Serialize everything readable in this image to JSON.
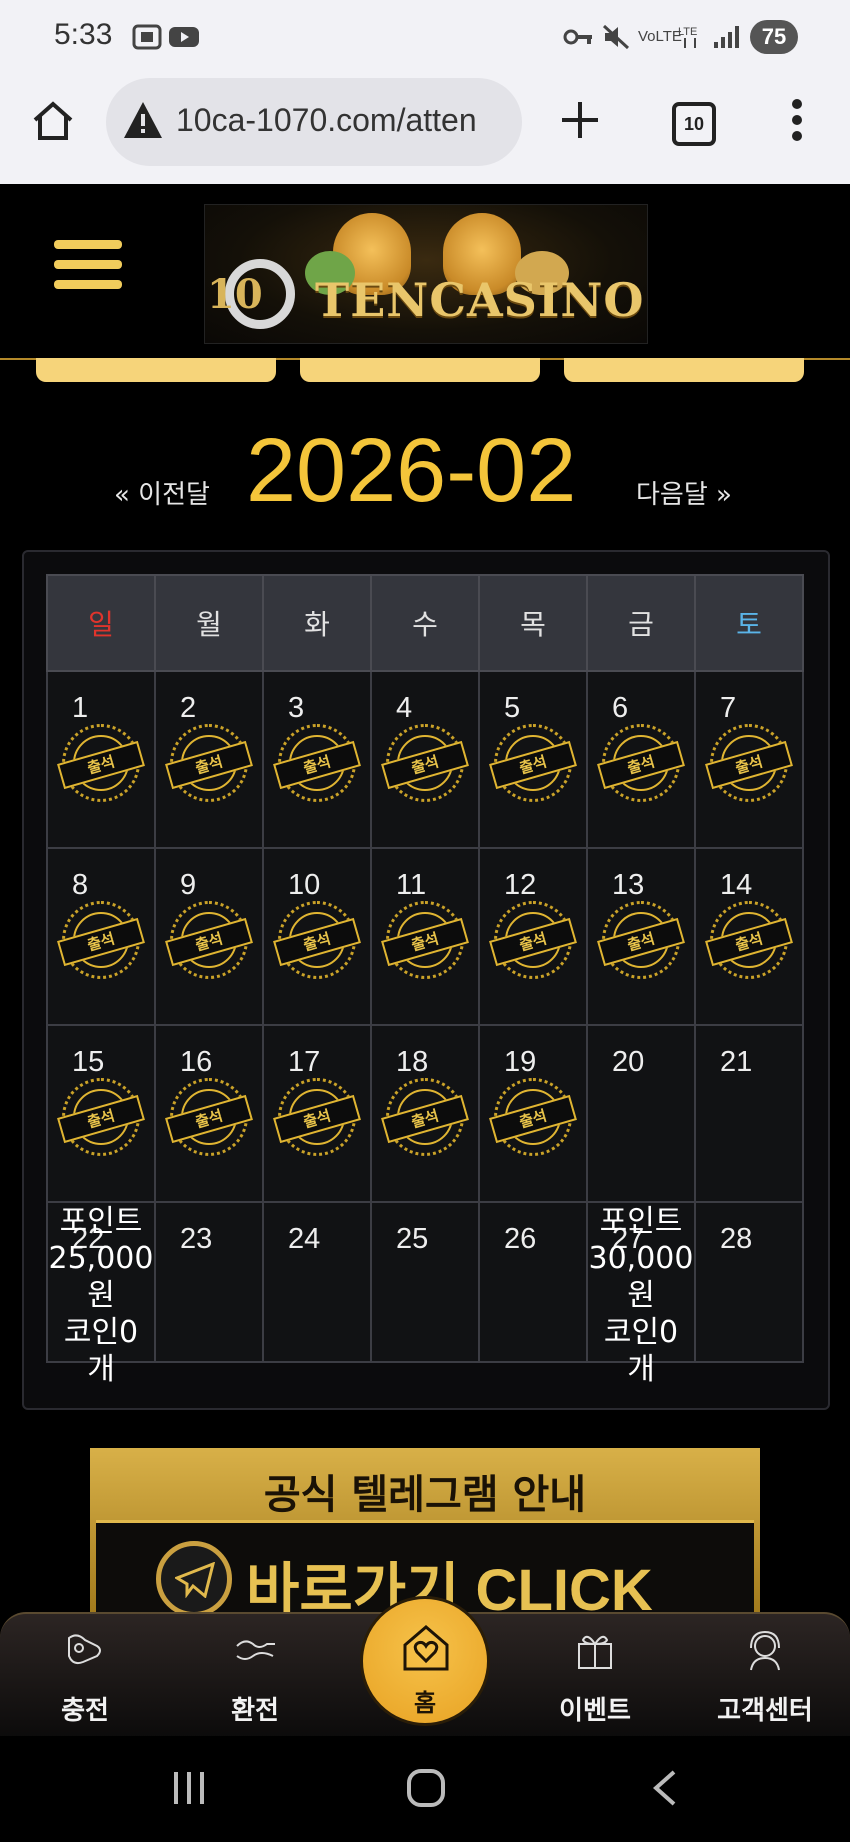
{
  "status_bar": {
    "time": "5:33",
    "battery": "75"
  },
  "browser": {
    "url": "10ca-1070.com/atten",
    "tab_count": "10"
  },
  "site": {
    "logo_text": "TENCASINO",
    "logo_prefix": "10"
  },
  "calendar": {
    "prev_label": "« 이전달",
    "next_label": "다음달 »",
    "month": "2026-02",
    "weekdays": [
      "일",
      "월",
      "화",
      "수",
      "목",
      "금",
      "토"
    ],
    "stamp_text": "출석",
    "weeks": [
      [
        {
          "day": "1",
          "stamp": true
        },
        {
          "day": "2",
          "stamp": true
        },
        {
          "day": "3",
          "stamp": true
        },
        {
          "day": "4",
          "stamp": true
        },
        {
          "day": "5",
          "stamp": true
        },
        {
          "day": "6",
          "stamp": true
        },
        {
          "day": "7",
          "stamp": true
        }
      ],
      [
        {
          "day": "8",
          "stamp": true
        },
        {
          "day": "9",
          "stamp": true
        },
        {
          "day": "10",
          "stamp": true
        },
        {
          "day": "11",
          "stamp": true
        },
        {
          "day": "12",
          "stamp": true
        },
        {
          "day": "13",
          "stamp": true
        },
        {
          "day": "14",
          "stamp": true
        }
      ],
      [
        {
          "day": "15",
          "stamp": true
        },
        {
          "day": "16",
          "stamp": true
        },
        {
          "day": "17",
          "stamp": true
        },
        {
          "day": "18",
          "stamp": true
        },
        {
          "day": "19",
          "stamp": true
        },
        {
          "day": "20",
          "stamp": false
        },
        {
          "day": "21",
          "stamp": false
        }
      ],
      [
        {
          "day": "22",
          "stamp": false,
          "reward": [
            "포인트",
            "25,000",
            "원",
            "코인0",
            "개"
          ]
        },
        {
          "day": "23",
          "stamp": false
        },
        {
          "day": "24",
          "stamp": false
        },
        {
          "day": "25",
          "stamp": false
        },
        {
          "day": "26",
          "stamp": false
        },
        {
          "day": "27",
          "stamp": false,
          "reward": [
            "포인트",
            "30,000",
            "원",
            "코인0",
            "개"
          ]
        },
        {
          "day": "28",
          "stamp": false
        }
      ]
    ],
    "colors": {
      "sunday": "#e0342c",
      "saturday": "#5ab4e8",
      "month": "#f4c53a"
    }
  },
  "banner": {
    "title": "공식 텔레그램 안내",
    "cta": "바로가기 CLICK"
  },
  "bottom_nav": {
    "charge": "충전",
    "exchange": "환전",
    "home": "홈",
    "event": "이벤트",
    "support": "고객센터"
  }
}
